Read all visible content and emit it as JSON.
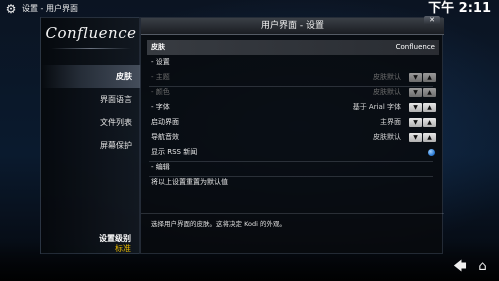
{
  "topbar": {
    "gear_icon": "⚙",
    "breadcrumb": "设置 - 用户界面",
    "clock": "下午 2:11"
  },
  "sidebar": {
    "logo": "Confluence",
    "items": [
      {
        "label": "皮肤",
        "active": true
      },
      {
        "label": "界面语言",
        "active": false
      },
      {
        "label": "文件列表",
        "active": false
      },
      {
        "label": "屏幕保护",
        "active": false
      }
    ],
    "settings_level_label": "设置级别",
    "settings_level_value": "标准"
  },
  "dialog": {
    "title": "用户界面 - 设置",
    "close_label": "✕",
    "rows": [
      {
        "label": "皮肤",
        "value": "Confluence"
      },
      {
        "label": "- 设置"
      },
      {
        "label": "- 主题",
        "value": "皮肤默认"
      },
      {
        "label": "- 颜色",
        "value": "皮肤默认"
      },
      {
        "label": "- 字体",
        "value": "基于 Arial 字体"
      },
      {
        "label": "启动界面",
        "value": "主界面"
      },
      {
        "label": "导航音效",
        "value": "皮肤默认"
      },
      {
        "label": "显示 RSS 新闻"
      },
      {
        "label": "- 编辑"
      },
      {
        "label": "将以上设置重置为默认值"
      }
    ],
    "description": "选择用户界面的皮肤。这将决定 Kodi 的外观。"
  },
  "bottom": {
    "back_icon": "🡄",
    "home_icon": "⌂"
  },
  "colors": {
    "accent_yellow": "#e8b800",
    "radio_blue": "#2f7fd8",
    "background": "#0a1a2e"
  }
}
